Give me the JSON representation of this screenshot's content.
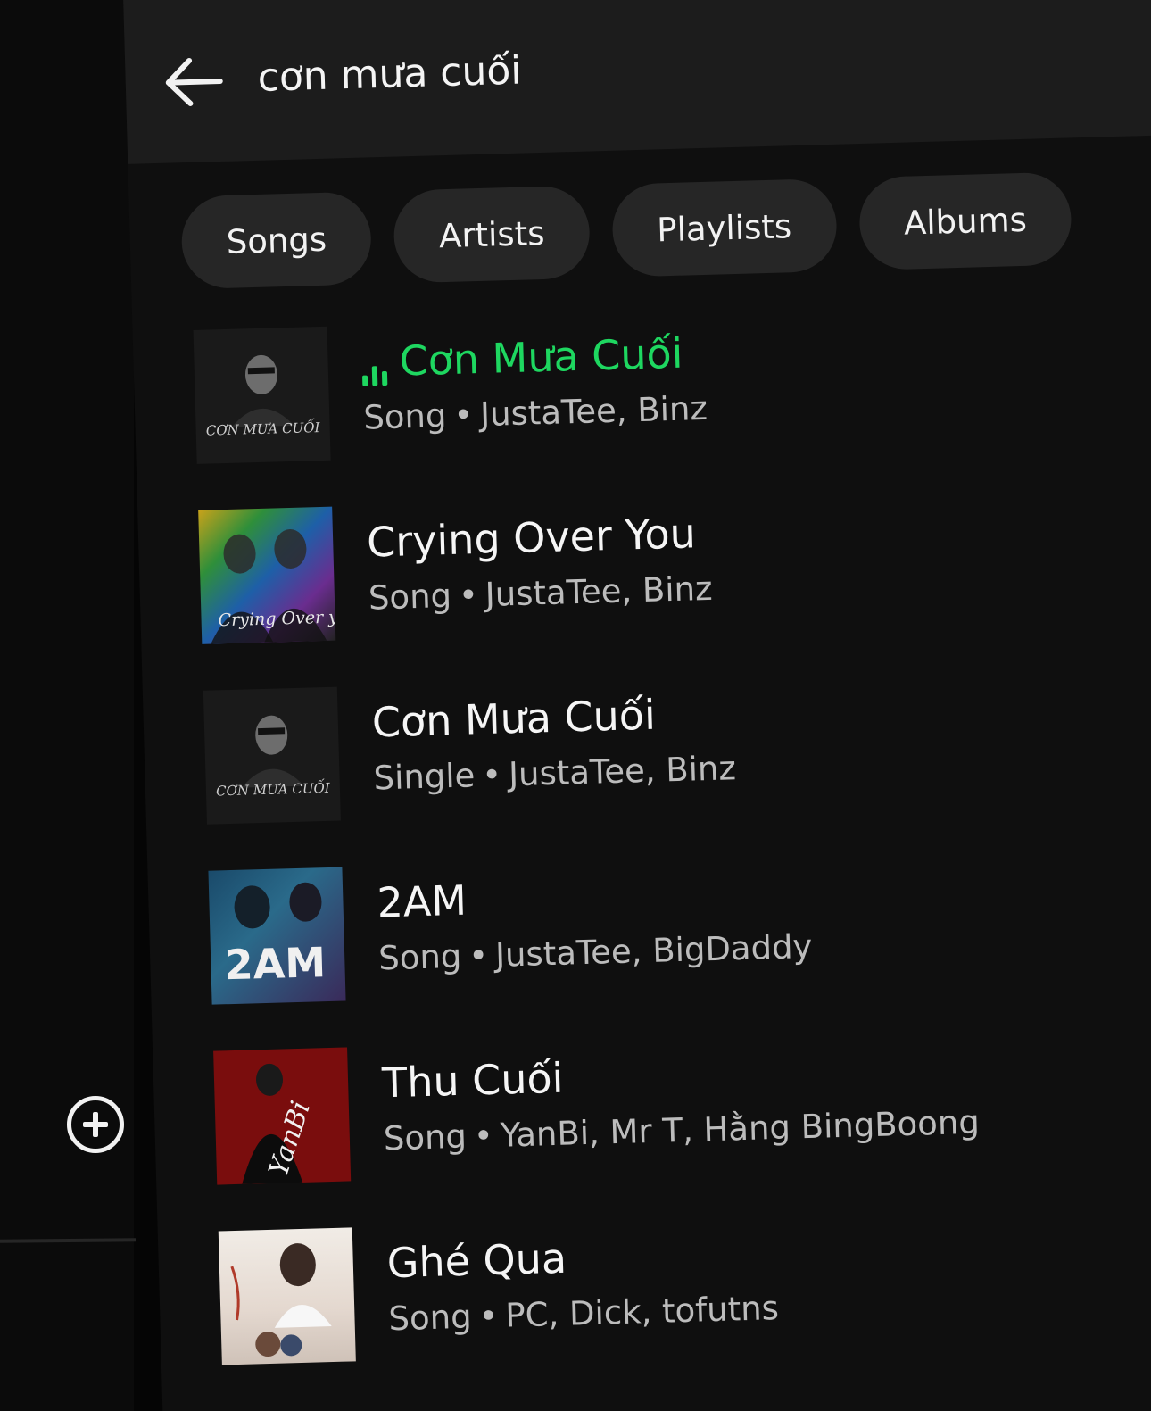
{
  "search": {
    "query": "cơn mưa cuối"
  },
  "filters": [
    "Songs",
    "Artists",
    "Playlists",
    "Albums"
  ],
  "results": [
    {
      "title": "Cơn Mưa Cuối",
      "type": "Song",
      "artists": "JustaTee, Binz",
      "playing": true,
      "art_text": "CƠN MƯA CUỐI"
    },
    {
      "title": "Crying Over You",
      "type": "Song",
      "artists": "JustaTee, Binz",
      "playing": false,
      "art_text": "Crying Over you"
    },
    {
      "title": "Cơn Mưa Cuối",
      "type": "Single",
      "artists": "JustaTee, Binz",
      "playing": false,
      "art_text": "CƠN MƯA CUỐI"
    },
    {
      "title": "2AM",
      "type": "Song",
      "artists": "JustaTee, BigDaddy",
      "playing": false,
      "art_text": "2AM"
    },
    {
      "title": "Thu Cuối",
      "type": "Song",
      "artists": "YanBi, Mr T, Hằng BingBoong",
      "playing": false,
      "art_text": "YanBi"
    },
    {
      "title": "Ghé Qua",
      "type": "Song",
      "artists": "PC, Dick, tofutns",
      "playing": false,
      "art_text": ""
    }
  ],
  "colors": {
    "accent": "#1ed760",
    "background": "#0f0f0f",
    "chip": "#262626",
    "header": "#1c1c1c"
  },
  "icons": {
    "back": "arrow-left-icon",
    "add": "plus-circle-icon",
    "playing": "equalizer-icon"
  }
}
